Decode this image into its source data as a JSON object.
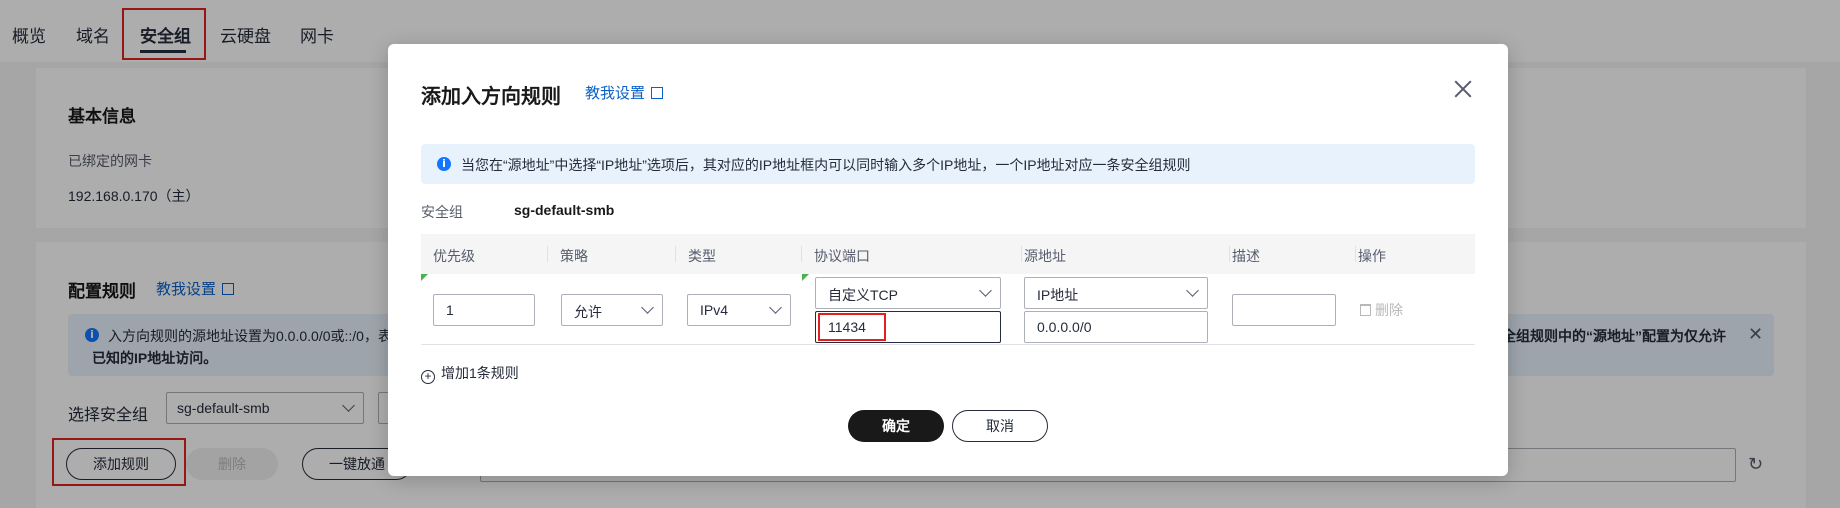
{
  "tabs": [
    "概览",
    "域名",
    "安全组",
    "云硬盘",
    "网卡"
  ],
  "basic_info": {
    "title": "基本信息",
    "nic_label": "已绑定的网卡",
    "nic_value": "192.168.0.170（主）"
  },
  "config": {
    "title": "配置规则",
    "help_link": "教我设置",
    "alert_line1_left": "入方向规则的源地址设置为0.0.0.0/0或::/0，表",
    "alert_line1_right": "全组规则中的“源地址”配置为仅允许",
    "alert_line2": "已知的IP地址访问。",
    "select_label": "选择安全组",
    "select_value": "sg-default-smb",
    "add_rule_btn": "添加规则",
    "delete_btn": "删除",
    "one_click_btn": "一键放通"
  },
  "modal": {
    "title": "添加入方向规则",
    "help_link": "教我设置",
    "alert": "当您在“源地址”中选择“IP地址”选项后，其对应的IP地址框内可以同时输入多个IP地址，一个IP地址对应一条安全组规则",
    "sg_label": "安全组",
    "sg_value": "sg-default-smb",
    "columns": [
      "优先级",
      "策略",
      "类型",
      "协议端口",
      "源地址",
      "描述",
      "操作"
    ],
    "row": {
      "priority": "1",
      "policy": "允许",
      "type": "IPv4",
      "protocol": "自定义TCP",
      "port": "11434",
      "source_type": "IP地址",
      "source_value": "0.0.0.0/0",
      "description": "",
      "op_delete": "删除"
    },
    "add_row": "增加1条规则",
    "confirm": "确定",
    "cancel": "取消"
  },
  "colors": {
    "accent_link": "#0c61c9",
    "info_blue": "#1476ff",
    "highlight_red": "#e0211e",
    "primary_button": "#191919"
  }
}
